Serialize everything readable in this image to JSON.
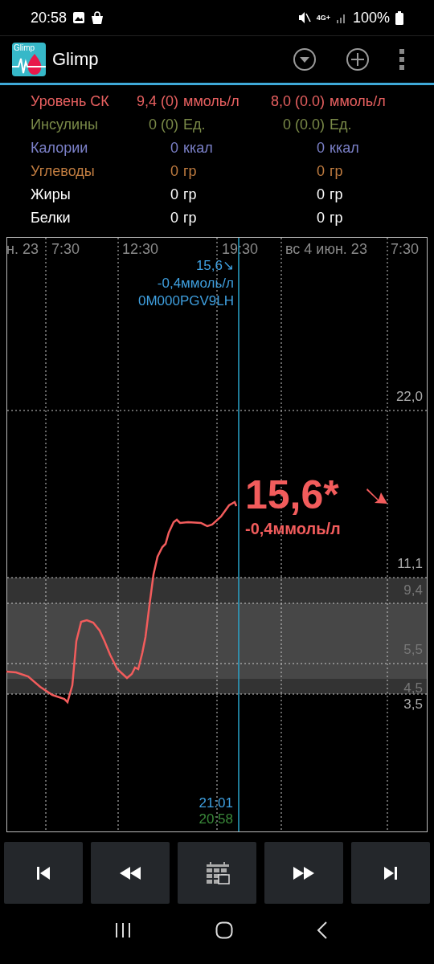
{
  "status_bar": {
    "time": "20:58",
    "network": "4G+",
    "battery": "100%"
  },
  "app_bar": {
    "logo_text": "Glimp",
    "title": "Glimp"
  },
  "summary": [
    {
      "label": "Уровень СК",
      "color": "#e86060",
      "values": [
        {
          "number": "9,4 (0)",
          "unit": "ммоль/л"
        },
        {
          "number": "8,0 (0.0)",
          "unit": "ммоль/л"
        }
      ]
    },
    {
      "label": "Инсулины",
      "color": "#7a8a48",
      "values": [
        {
          "number": "0 (0)",
          "unit": "Ед."
        },
        {
          "number": "0 (0.0)",
          "unit": "Ед."
        }
      ]
    },
    {
      "label": "Калории",
      "color": "#7b80c8",
      "values": [
        {
          "number": "0",
          "unit": "ккал"
        },
        {
          "number": "0",
          "unit": "ккал"
        }
      ]
    },
    {
      "label": "Углеводы",
      "color": "#c07c40",
      "values": [
        {
          "number": "0",
          "unit": "гр"
        },
        {
          "number": "0",
          "unit": "гр"
        }
      ]
    },
    {
      "label": "Жиры",
      "color": "#ffffff",
      "values": [
        {
          "number": "0",
          "unit": "гр"
        },
        {
          "number": "0",
          "unit": "гр"
        }
      ]
    },
    {
      "label": "Белки",
      "color": "#ffffff",
      "values": [
        {
          "number": "0",
          "unit": "гр"
        },
        {
          "number": "0",
          "unit": "гр"
        }
      ]
    }
  ],
  "graph": {
    "time_labels": [
      "н. 23",
      "7:30",
      "12:30",
      "19:30",
      "вс 4 июн. 23",
      "7:30"
    ],
    "y_labels": [
      {
        "text": "22,0",
        "kind": "line"
      },
      {
        "text": "11,1",
        "kind": "line"
      },
      {
        "text": "9,4",
        "kind": "band"
      },
      {
        "text": "5,5",
        "kind": "band"
      },
      {
        "text": "4,5",
        "kind": "band"
      },
      {
        "text": "3,5",
        "kind": "line"
      }
    ],
    "cursor_info": [
      "15,6↘",
      "-0,4ммоль/л",
      "0M000PGV9LH"
    ],
    "current_value": "15,6*",
    "current_delta": "-0,4ммоль/л",
    "cursor_time": "21:01",
    "now_time": "20:58"
  },
  "controls": [
    {
      "kind": "first"
    },
    {
      "kind": "back"
    },
    {
      "kind": "calendar"
    },
    {
      "kind": "forward"
    },
    {
      "kind": "last"
    }
  ]
}
